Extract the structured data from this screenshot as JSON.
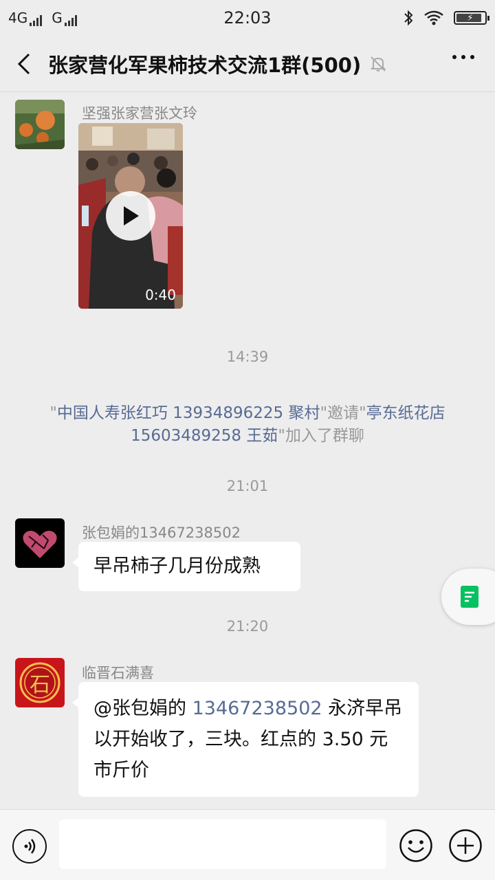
{
  "status": {
    "network1": "4G",
    "network2": "G",
    "time": "22:03"
  },
  "header": {
    "title": "张家营化军果柿技术交流1群(500)"
  },
  "messages": {
    "msg1": {
      "sender": "坚强张家营张文玲",
      "video_duration": "0:40"
    },
    "ts1": "14:39",
    "system": {
      "q1": "\"",
      "inviter": "中国人寿张红巧 13934896225 聚村",
      "mid": "\"邀请\"",
      "invitee": "亭东纸花店 15603489258 王茹",
      "tail": "\"加入了群聊"
    },
    "ts2": "21:01",
    "msg2": {
      "sender": "张包娟的13467238502",
      "text": "早吊柿子几月份成熟"
    },
    "ts3": "21:20",
    "msg3": {
      "sender": "临晋石满喜",
      "mention_prefix": "@张包娟的 ",
      "mention_number": "13467238502",
      "text_rest": " 永济早吊以开始收了，三块。红点的 3.50 元市斤价",
      "avatar_char": "石"
    }
  },
  "input": {
    "placeholder": ""
  },
  "colors": {
    "background": "#ededed",
    "link": "#576b95",
    "accent_green": "#07c160"
  }
}
